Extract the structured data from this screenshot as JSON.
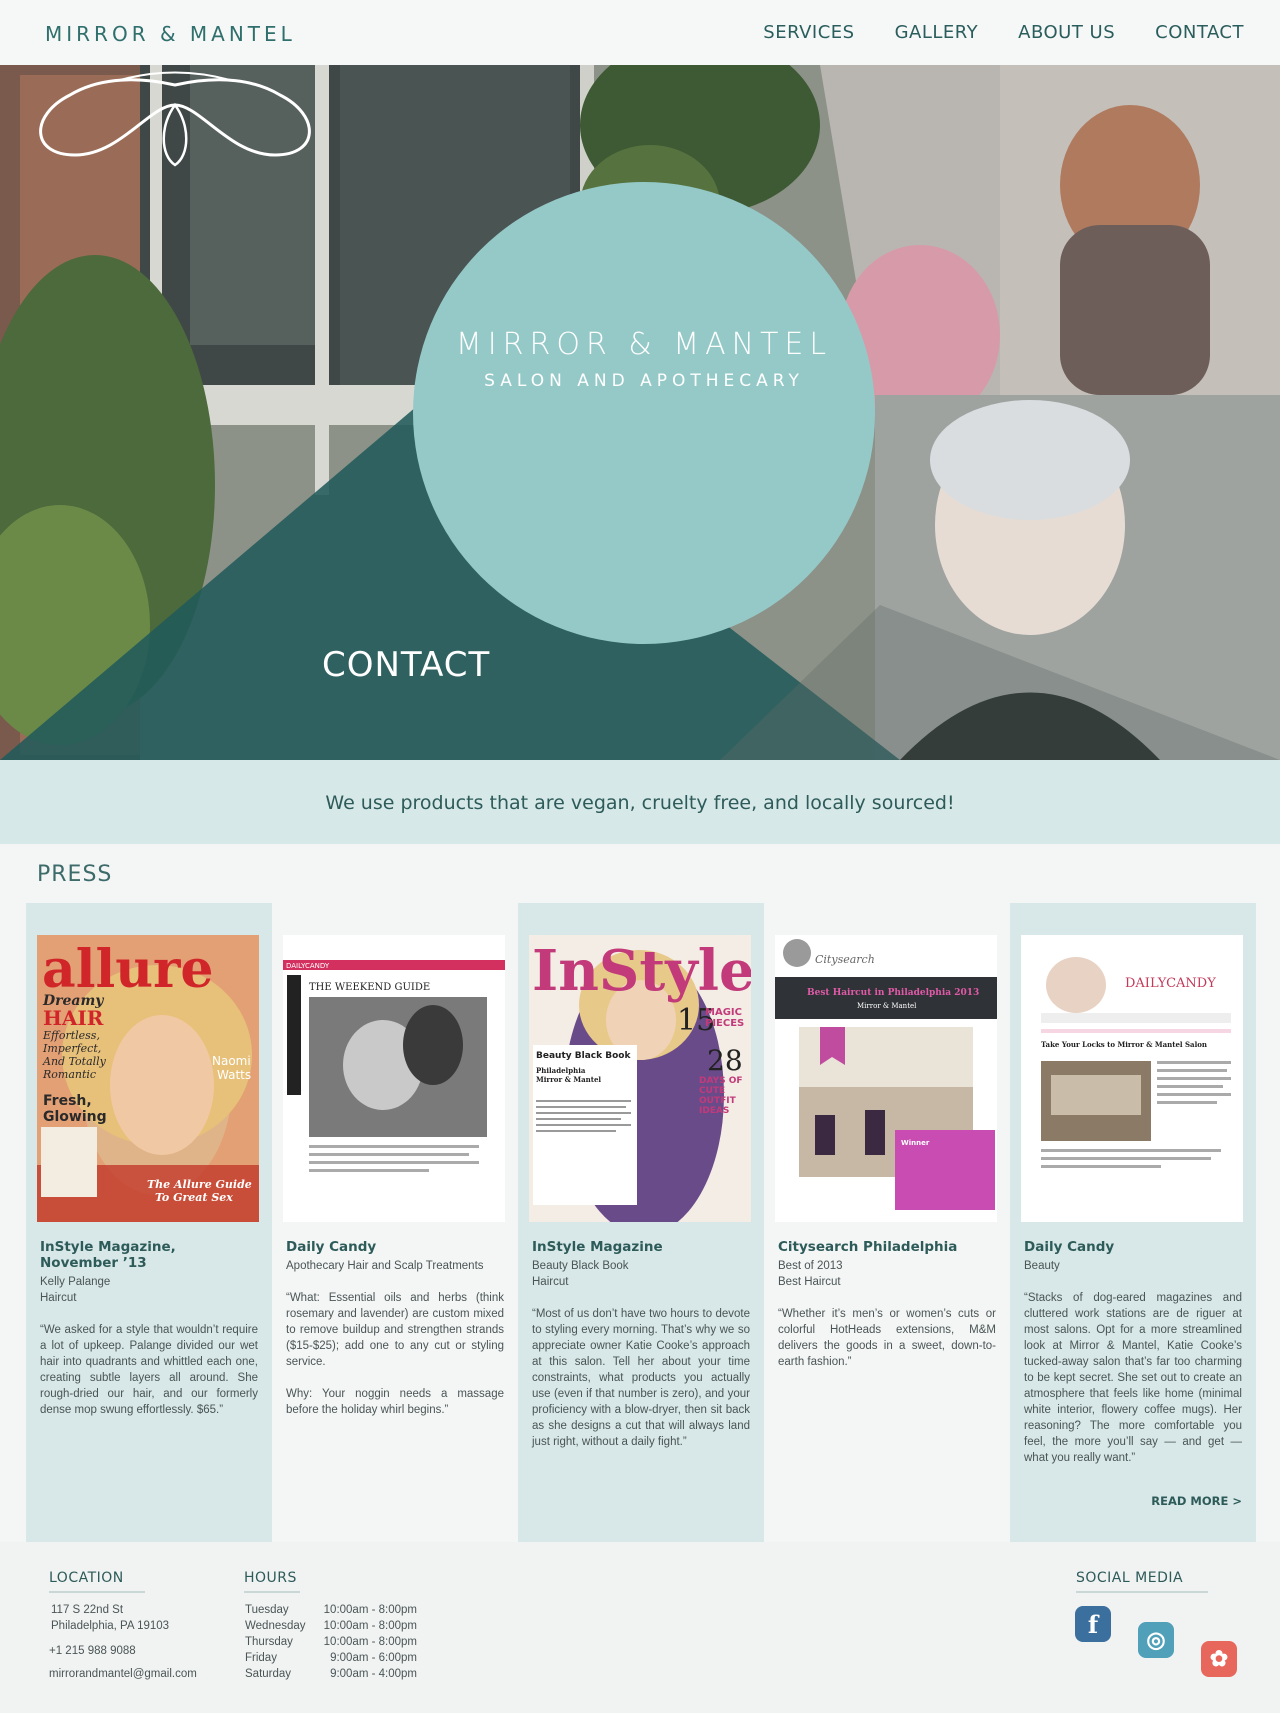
{
  "header": {
    "brand": "MIRROR & MANTEL",
    "nav": [
      "SERVICES",
      "GALLERY",
      "ABOUT US",
      "CONTACT"
    ]
  },
  "hero": {
    "title": "MIRROR & MANTEL",
    "subtitle": "SALON AND APOTHECARY",
    "page_label": "CONTACT",
    "storefront_sign_line1": "MIRROR & MANTEL",
    "storefront_sign_line2": "SALON AND APOTHECARY"
  },
  "banner": {
    "text": "We use products that are vegan, cruelty free, and locally sourced!"
  },
  "press": {
    "heading": "PRESS",
    "items": [
      {
        "title": "InStyle Magazine, November ’13",
        "sub1": "Kelly Palange",
        "sub2": "Haircut",
        "quote": "“We asked for a style that wouldn’t require a lot of upkeep. Palange divided our wet hair into quadrants and whittled each one, creating subtle layers all around. She rough-dried our hair, and our formerly dense mop swung effortlessly. $65.”",
        "thumb_masthead": "allure",
        "thumb_lines": [
          "Dreamy",
          "HAIR",
          "Effortless,",
          "Imperfect,",
          "And Totally",
          "Romantic",
          "Fresh,",
          "Glowing",
          "Naomi",
          "Watts",
          "The Allure Guide",
          "To Great Sex"
        ]
      },
      {
        "title": "Daily Candy",
        "sub1": "Apothecary Hair and Scalp Treatments",
        "sub2": "",
        "quote": "“What: Essential oils and herbs (think rosemary and lavender) are custom mixed to remove buildup and strengthen strands ($15-$25); add one to any cut or styling service.\n\nWhy: Your noggin needs a massage before the holiday whirl begins.”",
        "thumb_masthead": "DAILYCANDY",
        "thumb_lines": [
          "THE WEEKEND GUIDE"
        ]
      },
      {
        "title": "InStyle Magazine",
        "sub1": "Beauty Black Book",
        "sub2": "Haircut",
        "quote": "“Most of us don’t have two hours to devote to styling every morning. That’s why we so appreciate owner Katie Cooke’s approach at this salon. Tell her about your time constraints, what products you actually use (even if that number is zero), and your proficiency with a blow-dryer, then sit back as she designs a cut that will always land just right, without a daily fight.”",
        "thumb_masthead": "InStyle",
        "thumb_lines": [
          "15",
          "MAGIC",
          "PIECES",
          "28",
          "DAYS OF",
          "CUTE",
          "OUTFIT",
          "IDEAS",
          "Beauty Black Book",
          "Philadelphia",
          "Mirror & Mantel"
        ]
      },
      {
        "title": "Citysearch Philadelphia",
        "sub1": "Best of 2013",
        "sub2": "Best Haircut",
        "quote": "“Whether it’s men’s or women’s cuts or colorful HotHeads extensions, M&M delivers the goods in a sweet, down-to-earth fashion.”",
        "thumb_masthead": "Citysearch",
        "thumb_lines": [
          "Best Haircut in Philadelphia 2013",
          "Mirror & Mantel",
          "Winner"
        ]
      },
      {
        "title": "Daily Candy",
        "sub1": "Beauty",
        "sub2": "",
        "quote": "“Stacks of dog-eared magazines and cluttered work stations are de riguer at most salons. Opt for a more streamlined look at Mirror & Mantel, Katie Cooke’s tucked-away salon that’s far too charming to be kept secret. She set out to create an atmosphere that feels like home (minimal white interior, flowery coffee mugs). Her reasoning? The more comfortable you feel, the more you’ll say — and get — what you really want.”",
        "thumb_masthead": "DAILYCANDY",
        "thumb_lines": [
          "Take Your Locks to Mirror & Mantel Salon"
        ],
        "read_more": "READ MORE  >"
      }
    ]
  },
  "footer": {
    "location": {
      "heading": "LOCATION",
      "address1": "117 S 22nd St",
      "address2": "Philadelphia, PA 19103",
      "phone": "+1 215 988 9088",
      "email": "mirrorandmantel@gmail.com"
    },
    "hours": {
      "heading": "HOURS",
      "rows": [
        {
          "day": "Tuesday",
          "time": "10:00am - 8:00pm"
        },
        {
          "day": "Wednesday",
          "time": "10:00am - 8:00pm"
        },
        {
          "day": "Thursday",
          "time": "10:00am - 8:00pm"
        },
        {
          "day": "Friday",
          "time": "9:00am - 6:00pm"
        },
        {
          "day": "Saturday",
          "time": "9:00am - 4:00pm"
        }
      ]
    },
    "social": {
      "heading": "SOCIAL MEDIA",
      "icons": [
        {
          "name": "facebook-icon",
          "glyph": "f",
          "color": "#3b6f9e"
        },
        {
          "name": "instagram-icon",
          "glyph": "◎",
          "color": "#4fa0b8"
        },
        {
          "name": "yelp-icon",
          "glyph": "✿",
          "color": "#e8675c"
        }
      ]
    }
  },
  "colors": {
    "teal_dark": "#2d5b59",
    "teal_circle": "#95c9c8",
    "teal_overlay": "#215a5a",
    "banner_bg": "#d7e8e8"
  }
}
